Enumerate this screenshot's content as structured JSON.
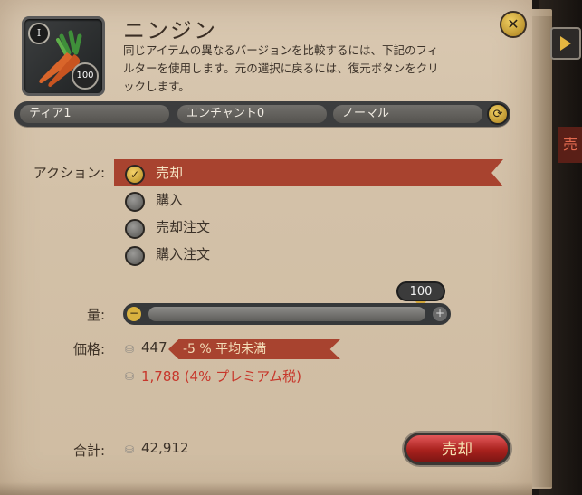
{
  "item": {
    "name": "ニンジン",
    "tier_badge": "I",
    "quantity_badge": "100",
    "description": "同じアイテムの異なるバージョンを比較するには、下記のフィルターを使用します。元の選択に戻るには、復元ボタンをクリックします。"
  },
  "filters": {
    "tier": "ティア1",
    "enchant": "エンチャント0",
    "quality": "ノーマル"
  },
  "action": {
    "label": "アクション:",
    "options": [
      {
        "label": "売却",
        "selected": true
      },
      {
        "label": "購入",
        "selected": false
      },
      {
        "label": "売却注文",
        "selected": false
      },
      {
        "label": "購入注文",
        "selected": false
      }
    ]
  },
  "quantity": {
    "label": "量:",
    "value": "100",
    "fraction": 1.0
  },
  "price": {
    "label": "価格:",
    "value": "447",
    "tag": "-5 % 平均未満",
    "premium": "1,788 (4% プレミアム税)"
  },
  "total": {
    "label": "合計:",
    "value": "42,912"
  },
  "sell_button": "売却",
  "side_tab_text": "売",
  "colors": {
    "accent_red": "#a8432f",
    "gold": "#d9b13f",
    "parchment": "#d3c1a8"
  }
}
